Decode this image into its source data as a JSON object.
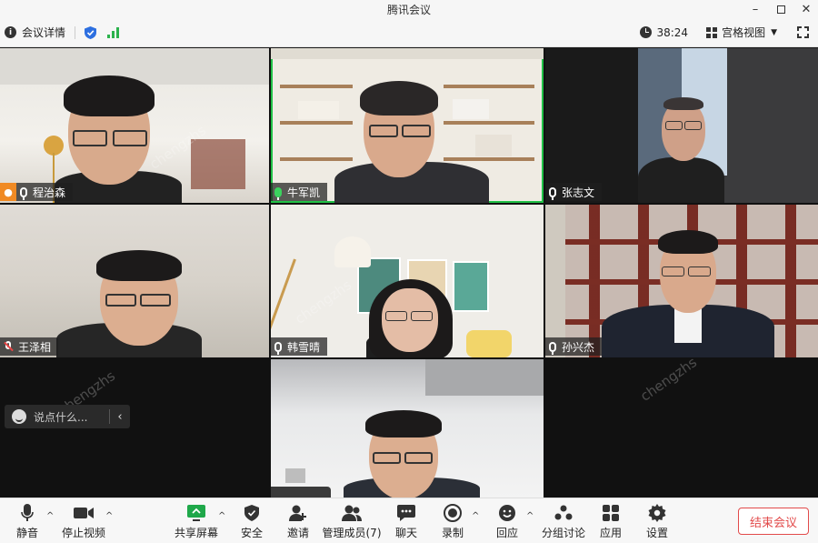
{
  "window": {
    "title": "腾讯会议"
  },
  "infobar": {
    "meeting_details": "会议详情",
    "timer": "38:24",
    "view_mode": "宫格视图"
  },
  "participants": [
    {
      "name": "程治森"
    },
    {
      "name": "牛军凯"
    },
    {
      "name": "张志文"
    },
    {
      "name": "王泽相"
    },
    {
      "name": "韩雪晴"
    },
    {
      "name": "孙兴杰"
    }
  ],
  "watermark": "chengzhs",
  "chat": {
    "placeholder": "说点什么..."
  },
  "toolbar": {
    "mute": "静音",
    "stop_video": "停止视频",
    "share_screen": "共享屏幕",
    "security": "安全",
    "invite": "邀请",
    "members": "管理成员(7)",
    "chat": "聊天",
    "record": "录制",
    "reactions": "回应",
    "breakout": "分组讨论",
    "apps": "应用",
    "settings": "设置",
    "end_meeting": "结束会议"
  },
  "colors": {
    "accent_green": "#21c147",
    "end_red": "#e24a4a",
    "speaker_badge": "#f08a24"
  }
}
